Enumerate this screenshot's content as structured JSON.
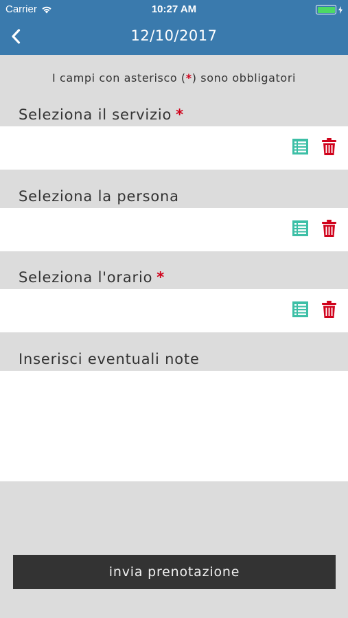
{
  "status_bar": {
    "carrier": "Carrier",
    "time": "10:27 AM",
    "battery_level": 1.0,
    "battery_color": "#4cd964"
  },
  "nav": {
    "back_icon": "chevron-left-icon",
    "title": "12/10/2017",
    "color": "#3a7aad"
  },
  "form": {
    "notice_before": "I campi con asterisco (",
    "notice_asterisk": "*",
    "notice_after": ") sono obbligatori",
    "fields": [
      {
        "label": "Seleziona il servizio",
        "required_mark": "*",
        "value": "",
        "list_icon": "list-icon",
        "delete_icon": "trash-icon"
      },
      {
        "label": "Seleziona la persona",
        "required_mark": "",
        "value": "",
        "list_icon": "list-icon",
        "delete_icon": "trash-icon"
      },
      {
        "label": "Seleziona l'orario",
        "required_mark": "*",
        "value": "",
        "list_icon": "list-icon",
        "delete_icon": "trash-icon"
      }
    ],
    "notes_label": "Inserisci eventuali note",
    "notes_value": "",
    "submit_label": "invia prenotazione"
  },
  "colors": {
    "accent_list": "#3dbfa6",
    "delete": "#d0021b",
    "required": "#d0021b",
    "background": "#dcdcdc",
    "button": "#333333"
  }
}
